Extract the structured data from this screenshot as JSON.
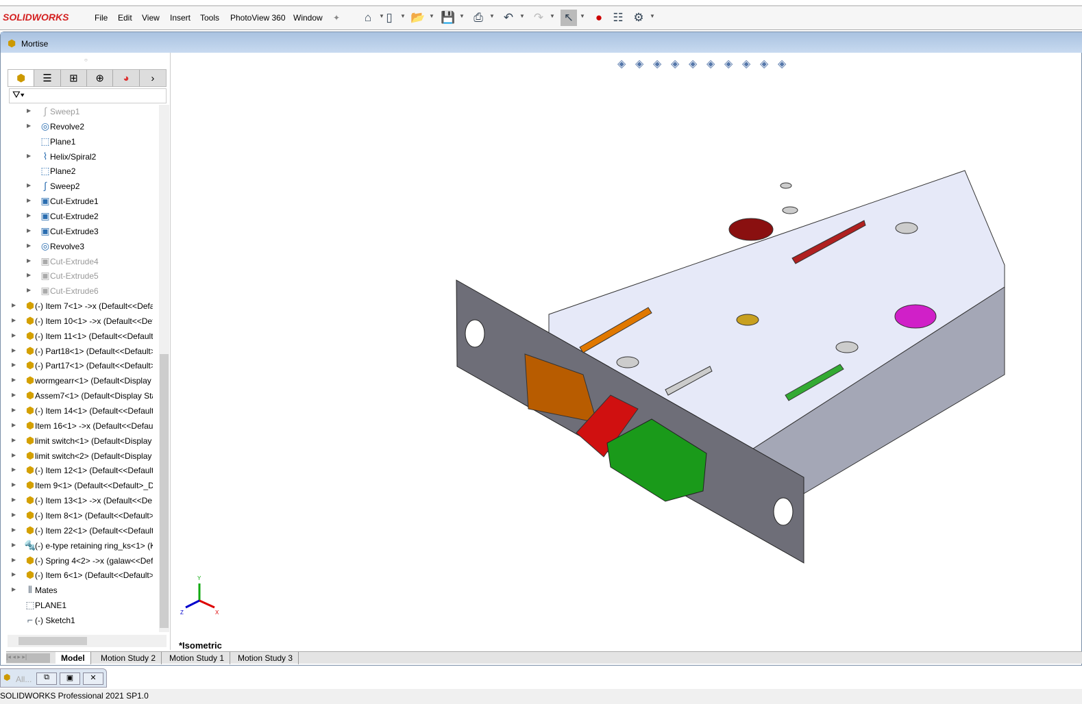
{
  "app": {
    "logo": "SOLIDWORKS",
    "status": "SOLIDWORKS Professional 2021 SP1.0"
  },
  "menu": [
    "File",
    "Edit",
    "View",
    "Insert",
    "Tools",
    "PhotoView 360",
    "Window"
  ],
  "toolbar": {
    "icons": [
      "home-icon",
      "new-document-icon",
      "open-icon",
      "save-icon",
      "print-icon",
      "undo-icon",
      "redo-icon",
      "select-icon",
      "traffic-light-icon",
      "file-properties-icon",
      "options-gear-icon"
    ]
  },
  "document": {
    "title": "Mortise",
    "view_label": "*Isometric"
  },
  "feature_manager": {
    "tabs": [
      "feature-tree",
      "property-manager",
      "configuration-manager",
      "dimxpert",
      "display-manager"
    ],
    "features": [
      {
        "label": "Sweep1",
        "icon": "sweep-icon",
        "expand": true,
        "suppressed": true
      },
      {
        "label": "Revolve2",
        "icon": "revolve-icon",
        "expand": true,
        "suppressed": false
      },
      {
        "label": "Plane1",
        "icon": "plane-icon",
        "expand": false,
        "suppressed": false
      },
      {
        "label": "Helix/Spiral2",
        "icon": "helix-icon",
        "expand": true,
        "suppressed": false
      },
      {
        "label": "Plane2",
        "icon": "plane-icon",
        "expand": false,
        "suppressed": false
      },
      {
        "label": "Sweep2",
        "icon": "sweep-icon",
        "expand": true,
        "suppressed": false
      },
      {
        "label": "Cut-Extrude1",
        "icon": "cut-extrude-icon",
        "expand": true,
        "suppressed": false
      },
      {
        "label": "Cut-Extrude2",
        "icon": "cut-extrude-icon",
        "expand": true,
        "suppressed": false
      },
      {
        "label": "Cut-Extrude3",
        "icon": "cut-extrude-icon",
        "expand": true,
        "suppressed": false
      },
      {
        "label": "Revolve3",
        "icon": "revolve-icon",
        "expand": true,
        "suppressed": false
      },
      {
        "label": "Cut-Extrude4",
        "icon": "cut-extrude-icon",
        "expand": true,
        "suppressed": true
      },
      {
        "label": "Cut-Extrude5",
        "icon": "cut-extrude-icon",
        "expand": true,
        "suppressed": true
      },
      {
        "label": "Cut-Extrude6",
        "icon": "cut-extrude-icon",
        "expand": true,
        "suppressed": true
      }
    ],
    "components": [
      {
        "label": "(-) Item 7<1> ->x (Default<<Default",
        "icon": "part-icon",
        "expand": true
      },
      {
        "label": "(-) Item 10<1> ->x (Default<<Default",
        "icon": "part-icon",
        "expand": true
      },
      {
        "label": "(-) Item 11<1> (Default<<Default",
        "icon": "part-icon",
        "expand": true
      },
      {
        "label": "(-) Part18<1> (Default<<Default>",
        "icon": "part-icon",
        "expand": true
      },
      {
        "label": "(-) Part17<1> (Default<<Default>",
        "icon": "part-icon",
        "expand": true
      },
      {
        "label": "wormgearr<1> (Default<Display",
        "icon": "subassembly-icon",
        "expand": true
      },
      {
        "label": "Assem7<1> (Default<Display Sta",
        "icon": "subassembly-icon",
        "expand": true
      },
      {
        "label": "(-) Item 14<1> (Default<<Default",
        "icon": "part-icon",
        "expand": true
      },
      {
        "label": "Item 16<1> ->x (Default<<Defau",
        "icon": "part-icon",
        "expand": true
      },
      {
        "label": "limit switch<1> (Default<Display",
        "icon": "subassembly-icon",
        "expand": true
      },
      {
        "label": "limit switch<2> (Default<Display",
        "icon": "subassembly-icon",
        "expand": true
      },
      {
        "label": "(-) Item 12<1> (Default<<Default",
        "icon": "part-icon",
        "expand": true
      },
      {
        "label": "Item 9<1> (Default<<Default>_D",
        "icon": "part-icon",
        "expand": true
      },
      {
        "label": "(-) Item 13<1> ->x (Default<<De",
        "icon": "part-icon",
        "expand": true
      },
      {
        "label": "(-) Item 8<1> (Default<<Default>",
        "icon": "part-icon",
        "expand": true
      },
      {
        "label": "(-) Item 22<1> (Default<<Default",
        "icon": "part-icon",
        "expand": true
      },
      {
        "label": "(-) e-type retaining ring_ks<1> (K",
        "icon": "toolbox-part-icon",
        "expand": true
      },
      {
        "label": "(-) Spring 4<2> ->x (galaw<<Def",
        "icon": "part-icon",
        "expand": true
      },
      {
        "label": "(-) Item 6<1> (Default<<Default>",
        "icon": "part-icon",
        "expand": true
      },
      {
        "label": "Mates",
        "icon": "mates-icon",
        "expand": true
      },
      {
        "label": "PLANE1",
        "icon": "plane-icon",
        "expand": false
      },
      {
        "label": "(-) Sketch1",
        "icon": "sketch-icon",
        "expand": false
      }
    ]
  },
  "bottom_tabs": [
    {
      "label": "Model",
      "active": true
    },
    {
      "label": "Motion Study 2"
    },
    {
      "label": "Motion Study 1"
    },
    {
      "label": "Motion Study 3"
    }
  ],
  "window_taskbar": {
    "label": "All..."
  },
  "triad": {
    "x": "X",
    "y": "Y",
    "z": "Z"
  },
  "colors": {
    "title_gradient": "#b8cfea",
    "logo_red": "#d42020",
    "plate": "#6e6e78",
    "top_face": "#e6e9f8"
  }
}
